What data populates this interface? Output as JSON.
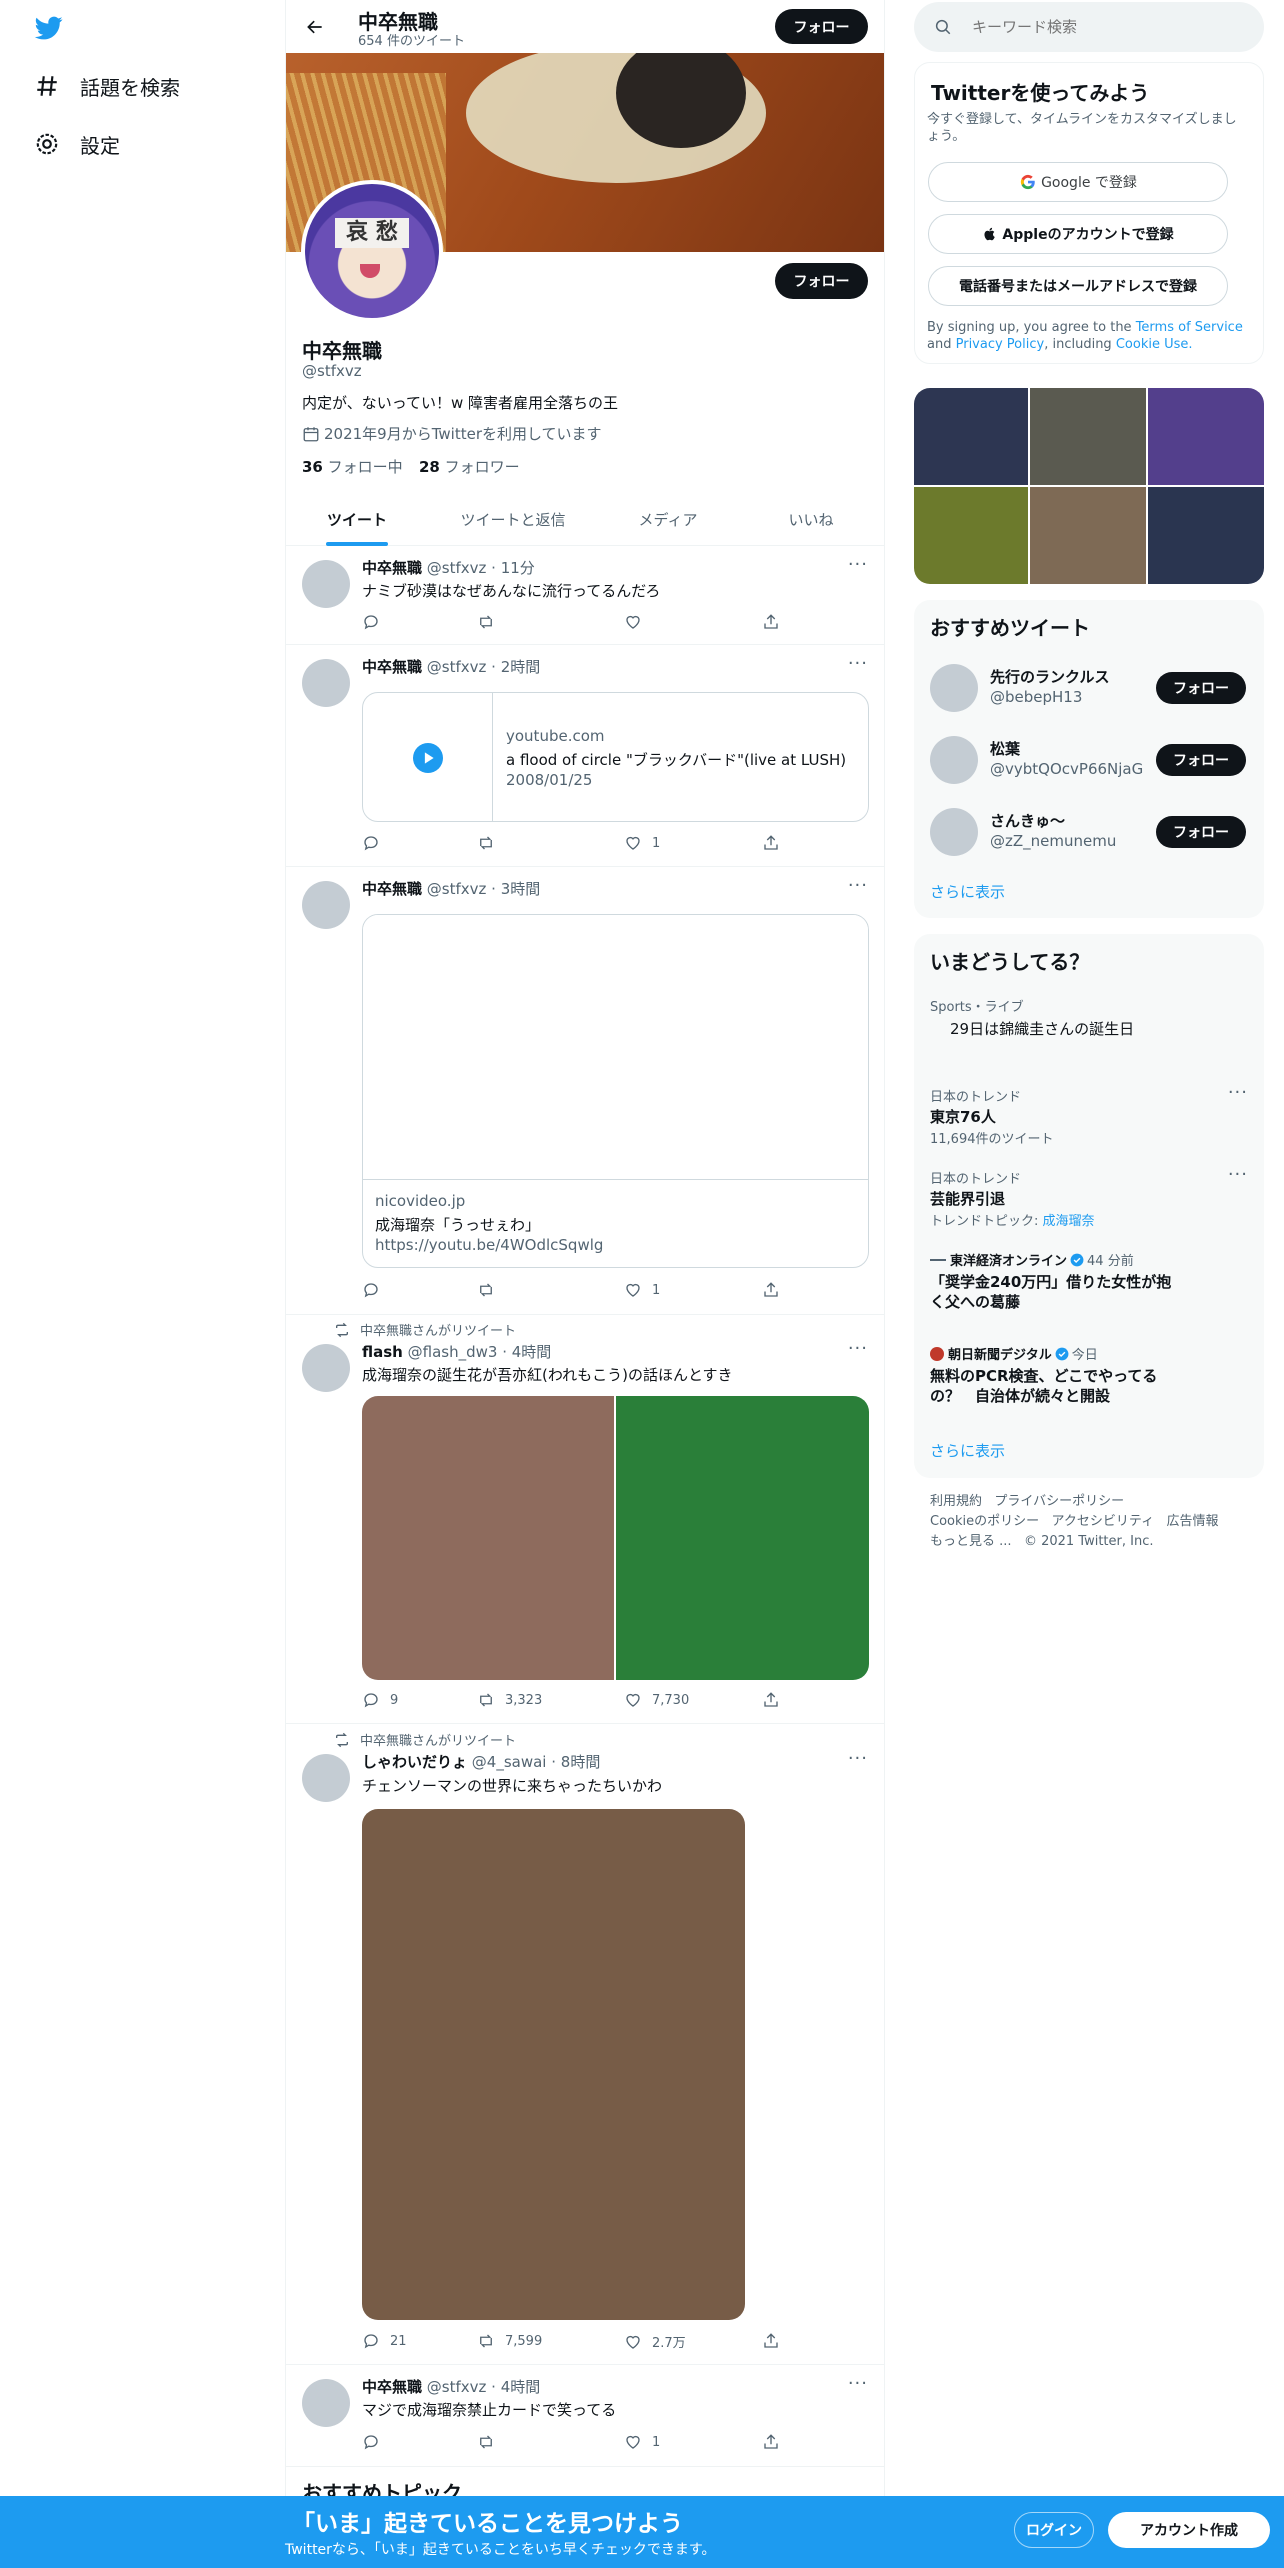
{
  "nav": {
    "explore_label": "話題を検索",
    "settings_label": "設定"
  },
  "header": {
    "name": "中卒無職",
    "tweet_count": "654 件のツイート",
    "follow_label": "フォロー"
  },
  "profile": {
    "name": "中卒無職",
    "handle": "@stfxvz",
    "bio": "内定が、ないってい！w 障害者雇用全落ちの王",
    "joined": "2021年9月からTwitterを利用しています",
    "following_count": "36",
    "following_label": "フォロー中",
    "followers_count": "28",
    "followers_label": "フォロワー",
    "follow_label": "フォロー",
    "avatar_text": "哀 愁"
  },
  "tabs": [
    "ツイート",
    "ツイートと返信",
    "メディア",
    "いいね"
  ],
  "tweets": [
    {
      "name": "中卒無職",
      "handle": "@stfxvz",
      "time": "11分",
      "text": "ナミブ砂漠はなぜあんなに流行ってるんだろ",
      "replies": "",
      "retweets": "",
      "likes": ""
    },
    {
      "name": "中卒無職",
      "handle": "@stfxvz",
      "time": "2時間",
      "card_domain": "youtube.com",
      "card_title": "a flood of circle \"ブラックバード\"(live at LUSH)",
      "card_date": "2008/01/25",
      "replies": "",
      "retweets": "",
      "likes": "1"
    },
    {
      "name": "中卒無職",
      "handle": "@stfxvz",
      "time": "3時間",
      "card_domain": "nicovideo.jp",
      "card_title": "成海瑠奈「うっせぇわ」",
      "card_url": "https://youtu.be/4WOdlcSqwlg",
      "replies": "",
      "retweets": "",
      "likes": "1"
    },
    {
      "retweet_note": "中卒無職さんがリツイート",
      "name": "flash",
      "handle": "@flash_dw3",
      "time": "4時間",
      "text": "成海瑠奈の誕生花が吾亦紅(われもこう)の話ほんとすき",
      "replies": "9",
      "retweets": "3,323",
      "likes": "7,730"
    },
    {
      "retweet_note": "中卒無職さんがリツイート",
      "name": "しゃわいだりょ",
      "handle": "@4_sawai",
      "time": "8時間",
      "text": "チェンソーマンの世界に来ちゃったちいかわ",
      "replies": "21",
      "retweets": "7,599",
      "likes": "2.7万"
    },
    {
      "name": "中卒無職",
      "handle": "@stfxvz",
      "time": "4時間",
      "text": "マジで成海瑠奈禁止カードで笑ってる",
      "replies": "",
      "retweets": "",
      "likes": "1"
    }
  ],
  "recommended_topics_heading": "おすすめトピック",
  "search": {
    "placeholder": "キーワード検索"
  },
  "signup": {
    "title": "Twitterを使ってみよう",
    "subtitle": "今すぐ登録して、タイムラインをカスタマイズしましょう。",
    "google_label": "Google で登録",
    "apple_label": "Appleのアカウントで登録",
    "phone_label": "電話番号またはメールアドレスで登録",
    "terms_prefix": "By signing up, you agree to the",
    "terms_link": "Terms of Service",
    "and": "and",
    "privacy_link": "Privacy Policy",
    "including": ", including",
    "cookie_link": "Cookie Use."
  },
  "recommended_users": {
    "title": "おすすめツイート",
    "users": [
      {
        "name": "先行のランクルス",
        "handle": "@bebepH13"
      },
      {
        "name": "松葉",
        "handle": "@vybtQOcvP66NjaG"
      },
      {
        "name": "さんきゅ〜",
        "handle": "@zZ_nemunemu"
      }
    ],
    "follow_label": "フォロー",
    "show_more": "さらに表示"
  },
  "trends": {
    "title": "いまどうしてる？",
    "items": [
      {
        "category": "Sports・ライブ",
        "name": "29日は錦織圭さんの誕生日"
      },
      {
        "category": "日本のトレンド",
        "name": "東京76人",
        "meta": "11,694件のツイート"
      },
      {
        "category": "日本のトレンド",
        "name": "芸能界引退",
        "meta_prefix": "トレンドトピック: ",
        "meta_link": "成海瑠奈"
      },
      {
        "source": "東洋経済オンライン",
        "time": "44 分前",
        "headline": "「奨学金240万円」借りた女性が抱く父への葛藤"
      },
      {
        "source": "朝日新聞デジタル",
        "time": "今日",
        "headline": "無料のPCR検査、どこでやってるの？　自治体が続々と開設"
      }
    ],
    "show_more": "さらに表示"
  },
  "footer": {
    "links": [
      "利用規約",
      "プライバシーポリシー",
      "Cookieのポリシー",
      "アクセシビリティ",
      "広告情報",
      "もっと見る ..."
    ],
    "copyright": "© 2021 Twitter, Inc."
  },
  "bottom_bar": {
    "title": "「いま」起きていることを見つけよう",
    "subtitle": "Twitterなら、「いま」起きていることをいち早くチェックできます。",
    "login_label": "ログイン",
    "signup_label": "アカウント作成"
  },
  "colors": {
    "accent": "#1d9bf0",
    "text": "#0f1419",
    "secondary": "#536471"
  }
}
